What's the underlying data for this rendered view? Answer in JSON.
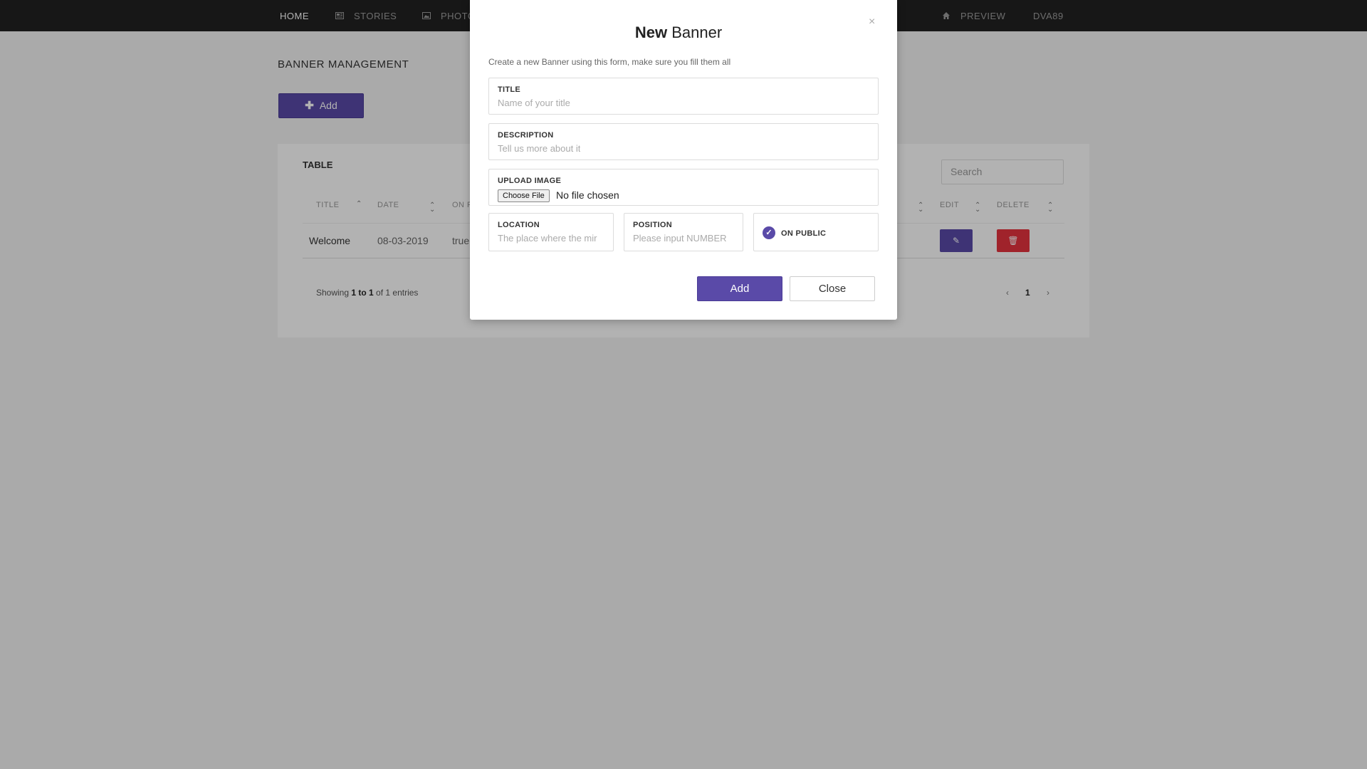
{
  "navbar": {
    "items": [
      {
        "label": "HOME",
        "icon": "none"
      },
      {
        "label": "STORIES",
        "icon": "newspaper-icon"
      },
      {
        "label": "PHOTO",
        "icon": "image-icon"
      },
      {
        "label": "PREVIEW",
        "icon": "home-icon"
      },
      {
        "label": "DVA89",
        "icon": "none"
      }
    ]
  },
  "page": {
    "title": "BANNER MANAGEMENT",
    "add_label": "Add"
  },
  "table": {
    "title": "TABLE",
    "search_placeholder": "Search",
    "columns": [
      "TITLE",
      "DATE",
      "ON P",
      "EDIT",
      "DELETE"
    ],
    "rows": [
      {
        "title": "Welcome",
        "date": "08-03-2019",
        "on_public": "true"
      }
    ],
    "showing": {
      "prefix": "Showing ",
      "range": "1 to 1",
      "suffix": " of 1 entries"
    },
    "pager": {
      "prev": "‹",
      "current": "1",
      "next": "›"
    }
  },
  "modal": {
    "close_glyph": "×",
    "title_bold": "New",
    "title_rest": " Banner",
    "subtitle": "Create a new Banner using this form, make sure you fill them all",
    "fields": {
      "title": {
        "label": "TITLE",
        "placeholder": "Name of your title"
      },
      "description": {
        "label": "DESCRIPTION",
        "placeholder": "Tell us more about it"
      },
      "upload": {
        "label": "UPLOAD IMAGE",
        "button": "Choose File",
        "status": "No file chosen"
      },
      "location": {
        "label": "LOCATION",
        "placeholder": "The place where the mir"
      },
      "position": {
        "label": "POSITION",
        "placeholder": "Please input NUMBER"
      },
      "on_public": {
        "label": "ON PUBLIC",
        "checked": true
      }
    },
    "add_label": "Add",
    "close_label": "Close"
  },
  "colors": {
    "accent": "#5a4aa8",
    "danger": "#e5333e",
    "navbar": "#222222"
  }
}
